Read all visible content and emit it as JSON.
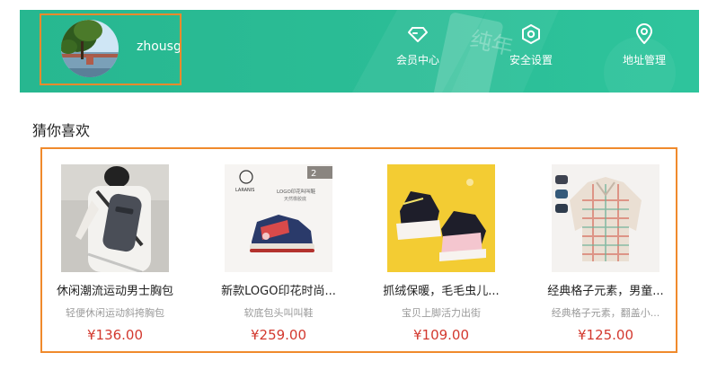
{
  "user": {
    "name": "zhousg"
  },
  "nav": [
    {
      "label": "会员中心",
      "icon": "diamond-icon"
    },
    {
      "label": "安全设置",
      "icon": "hexagon-shield-icon"
    },
    {
      "label": "地址管理",
      "icon": "location-pin-icon"
    }
  ],
  "banner_watermark": "纯年",
  "section": {
    "title": "猜你喜欢"
  },
  "goods": [
    {
      "name": "休闲潮流运动男士胸包",
      "desc": "轻便休闲运动斜挎胸包",
      "price": "¥136.00"
    },
    {
      "name": "新款LOGO印花时尚...",
      "desc": "软底包头叫叫鞋",
      "price": "¥259.00",
      "img_text": {
        "brand": "LARANIS",
        "badge": "2",
        "caption": "LOGO印花叫叫鞋",
        "sub": "天然橡胶底"
      }
    },
    {
      "name": "抓绒保暖，毛毛虫儿...",
      "desc": "宝贝上脚活力出街",
      "price": "¥109.00"
    },
    {
      "name": "经典格子元素，男童...",
      "desc": "经典格子元素，翻盖小...",
      "price": "¥125.00"
    }
  ],
  "colors": {
    "banner": "#2bbd96",
    "highlight_border": "#f08a2c",
    "price": "#d3392f"
  }
}
